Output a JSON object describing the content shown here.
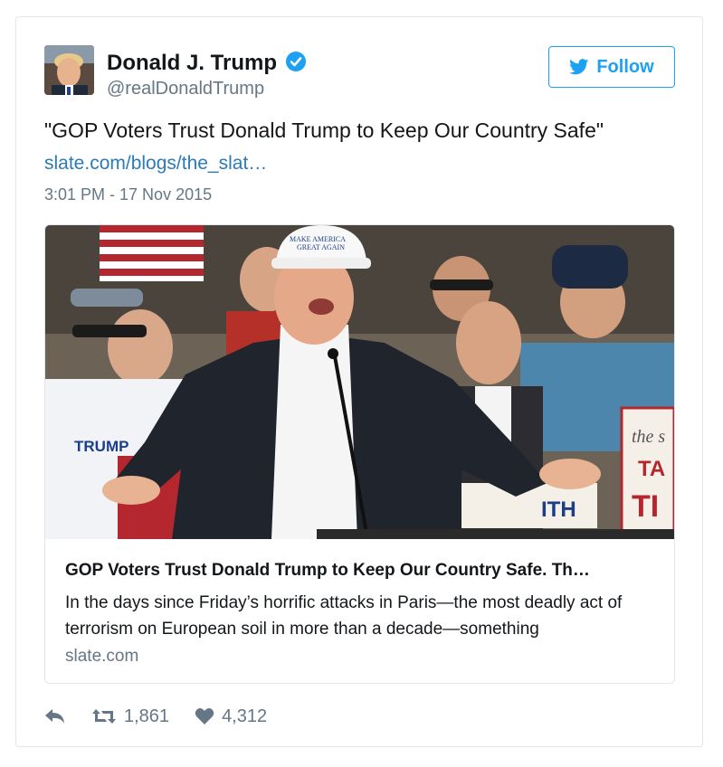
{
  "author": {
    "name": "Donald J. Trump",
    "handle": "@realDonaldTrump",
    "verified_icon": "verified-badge-icon"
  },
  "follow_button": {
    "label": "Follow",
    "icon": "twitter-bird-icon"
  },
  "tweet": {
    "text": "\"GOP Voters Trust Donald Trump to Keep Our Country Safe\"",
    "link": "slate.com/blogs/the_slat…",
    "timestamp": "3:01 PM - 17 Nov 2015"
  },
  "card": {
    "image_text": {
      "hat_line1": "MAKE AMERICA",
      "hat_line2": "GREAT AGAIN",
      "shirt": "TRUMP",
      "sign_line1": "the s",
      "sign_line2": "TA",
      "sign_line3": "TI",
      "sign_lower": "ITH"
    },
    "title": "GOP Voters Trust Donald Trump to Keep Our Country Safe. Th…",
    "description": "In the days since Friday’s horrific attacks in Paris—the most deadly act of terrorism on European soil in more than a decade—something",
    "domain": "slate.com"
  },
  "actions": {
    "reply_icon": "reply-icon",
    "retweet_icon": "retweet-icon",
    "retweet_count": "1,861",
    "like_icon": "heart-icon",
    "like_count": "4,312"
  },
  "colors": {
    "twitter_blue": "#1da1f2",
    "link_blue": "#2b7bb9",
    "muted_gray": "#657786",
    "border": "#e1e8ed"
  }
}
